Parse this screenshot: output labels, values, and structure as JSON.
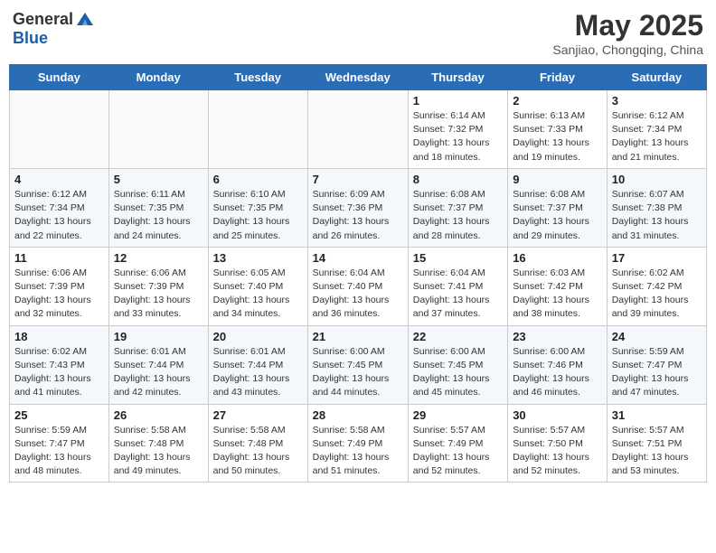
{
  "header": {
    "logo_general": "General",
    "logo_blue": "Blue",
    "month": "May 2025",
    "location": "Sanjiao, Chongqing, China"
  },
  "days_of_week": [
    "Sunday",
    "Monday",
    "Tuesday",
    "Wednesday",
    "Thursday",
    "Friday",
    "Saturday"
  ],
  "weeks": [
    [
      {
        "day": "",
        "info": ""
      },
      {
        "day": "",
        "info": ""
      },
      {
        "day": "",
        "info": ""
      },
      {
        "day": "",
        "info": ""
      },
      {
        "day": "1",
        "info": "Sunrise: 6:14 AM\nSunset: 7:32 PM\nDaylight: 13 hours\nand 18 minutes."
      },
      {
        "day": "2",
        "info": "Sunrise: 6:13 AM\nSunset: 7:33 PM\nDaylight: 13 hours\nand 19 minutes."
      },
      {
        "day": "3",
        "info": "Sunrise: 6:12 AM\nSunset: 7:34 PM\nDaylight: 13 hours\nand 21 minutes."
      }
    ],
    [
      {
        "day": "4",
        "info": "Sunrise: 6:12 AM\nSunset: 7:34 PM\nDaylight: 13 hours\nand 22 minutes."
      },
      {
        "day": "5",
        "info": "Sunrise: 6:11 AM\nSunset: 7:35 PM\nDaylight: 13 hours\nand 24 minutes."
      },
      {
        "day": "6",
        "info": "Sunrise: 6:10 AM\nSunset: 7:35 PM\nDaylight: 13 hours\nand 25 minutes."
      },
      {
        "day": "7",
        "info": "Sunrise: 6:09 AM\nSunset: 7:36 PM\nDaylight: 13 hours\nand 26 minutes."
      },
      {
        "day": "8",
        "info": "Sunrise: 6:08 AM\nSunset: 7:37 PM\nDaylight: 13 hours\nand 28 minutes."
      },
      {
        "day": "9",
        "info": "Sunrise: 6:08 AM\nSunset: 7:37 PM\nDaylight: 13 hours\nand 29 minutes."
      },
      {
        "day": "10",
        "info": "Sunrise: 6:07 AM\nSunset: 7:38 PM\nDaylight: 13 hours\nand 31 minutes."
      }
    ],
    [
      {
        "day": "11",
        "info": "Sunrise: 6:06 AM\nSunset: 7:39 PM\nDaylight: 13 hours\nand 32 minutes."
      },
      {
        "day": "12",
        "info": "Sunrise: 6:06 AM\nSunset: 7:39 PM\nDaylight: 13 hours\nand 33 minutes."
      },
      {
        "day": "13",
        "info": "Sunrise: 6:05 AM\nSunset: 7:40 PM\nDaylight: 13 hours\nand 34 minutes."
      },
      {
        "day": "14",
        "info": "Sunrise: 6:04 AM\nSunset: 7:40 PM\nDaylight: 13 hours\nand 36 minutes."
      },
      {
        "day": "15",
        "info": "Sunrise: 6:04 AM\nSunset: 7:41 PM\nDaylight: 13 hours\nand 37 minutes."
      },
      {
        "day": "16",
        "info": "Sunrise: 6:03 AM\nSunset: 7:42 PM\nDaylight: 13 hours\nand 38 minutes."
      },
      {
        "day": "17",
        "info": "Sunrise: 6:02 AM\nSunset: 7:42 PM\nDaylight: 13 hours\nand 39 minutes."
      }
    ],
    [
      {
        "day": "18",
        "info": "Sunrise: 6:02 AM\nSunset: 7:43 PM\nDaylight: 13 hours\nand 41 minutes."
      },
      {
        "day": "19",
        "info": "Sunrise: 6:01 AM\nSunset: 7:44 PM\nDaylight: 13 hours\nand 42 minutes."
      },
      {
        "day": "20",
        "info": "Sunrise: 6:01 AM\nSunset: 7:44 PM\nDaylight: 13 hours\nand 43 minutes."
      },
      {
        "day": "21",
        "info": "Sunrise: 6:00 AM\nSunset: 7:45 PM\nDaylight: 13 hours\nand 44 minutes."
      },
      {
        "day": "22",
        "info": "Sunrise: 6:00 AM\nSunset: 7:45 PM\nDaylight: 13 hours\nand 45 minutes."
      },
      {
        "day": "23",
        "info": "Sunrise: 6:00 AM\nSunset: 7:46 PM\nDaylight: 13 hours\nand 46 minutes."
      },
      {
        "day": "24",
        "info": "Sunrise: 5:59 AM\nSunset: 7:47 PM\nDaylight: 13 hours\nand 47 minutes."
      }
    ],
    [
      {
        "day": "25",
        "info": "Sunrise: 5:59 AM\nSunset: 7:47 PM\nDaylight: 13 hours\nand 48 minutes."
      },
      {
        "day": "26",
        "info": "Sunrise: 5:58 AM\nSunset: 7:48 PM\nDaylight: 13 hours\nand 49 minutes."
      },
      {
        "day": "27",
        "info": "Sunrise: 5:58 AM\nSunset: 7:48 PM\nDaylight: 13 hours\nand 50 minutes."
      },
      {
        "day": "28",
        "info": "Sunrise: 5:58 AM\nSunset: 7:49 PM\nDaylight: 13 hours\nand 51 minutes."
      },
      {
        "day": "29",
        "info": "Sunrise: 5:57 AM\nSunset: 7:49 PM\nDaylight: 13 hours\nand 52 minutes."
      },
      {
        "day": "30",
        "info": "Sunrise: 5:57 AM\nSunset: 7:50 PM\nDaylight: 13 hours\nand 52 minutes."
      },
      {
        "day": "31",
        "info": "Sunrise: 5:57 AM\nSunset: 7:51 PM\nDaylight: 13 hours\nand 53 minutes."
      }
    ]
  ]
}
